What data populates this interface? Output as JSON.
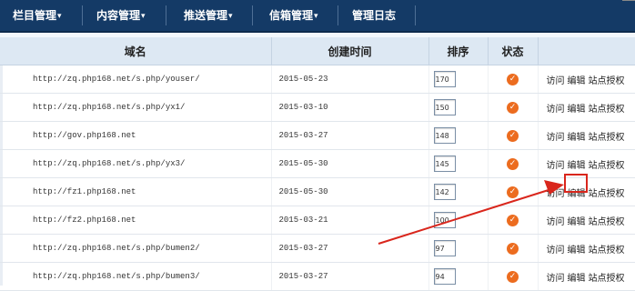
{
  "nav": {
    "items": [
      {
        "label": "栏目管理",
        "caret": "▾"
      },
      {
        "label": "内容管理",
        "caret": "▾"
      },
      {
        "label": "推送管理",
        "caret": "▾"
      },
      {
        "label": "信箱管理",
        "caret": "▾"
      },
      {
        "label": "管理日志",
        "caret": ""
      }
    ]
  },
  "table": {
    "headers": {
      "domain": "域名",
      "created": "创建时间",
      "sort": "排序",
      "status": "状态"
    },
    "actions": {
      "visit": "访问",
      "edit": "编辑",
      "authorize": "站点授权"
    },
    "rows": [
      {
        "domain": "http://zq.php168.net/s.php/youser/",
        "created": "2015-05-23",
        "sort": "170",
        "status": "check"
      },
      {
        "domain": "http://zq.php168.net/s.php/yx1/",
        "created": "2015-03-10",
        "sort": "150",
        "status": "check"
      },
      {
        "domain": "http://gov.php168.net",
        "created": "2015-03-27",
        "sort": "148",
        "status": "check"
      },
      {
        "domain": "http://zq.php168.net/s.php/yx3/",
        "created": "2015-05-30",
        "sort": "145",
        "status": "check"
      },
      {
        "domain": "http://fz1.php168.net",
        "created": "2015-05-30",
        "sort": "142",
        "status": "check"
      },
      {
        "domain": "http://fz2.php168.net",
        "created": "2015-03-21",
        "sort": "100",
        "status": "check"
      },
      {
        "domain": "http://zq.php168.net/s.php/bumen2/",
        "created": "2015-03-27",
        "sort": "97",
        "status": "check"
      },
      {
        "domain": "http://zq.php168.net/s.php/bumen3/",
        "created": "2015-03-27",
        "sort": "94",
        "status": "check"
      }
    ]
  },
  "colors": {
    "nav_bg": "#143a66",
    "header_bg": "#dde8f3",
    "status_icon": "#ec6c1f",
    "annotation": "#d9261c"
  },
  "annotation": {
    "icon": "red-arrow-pointing-to-edit"
  }
}
